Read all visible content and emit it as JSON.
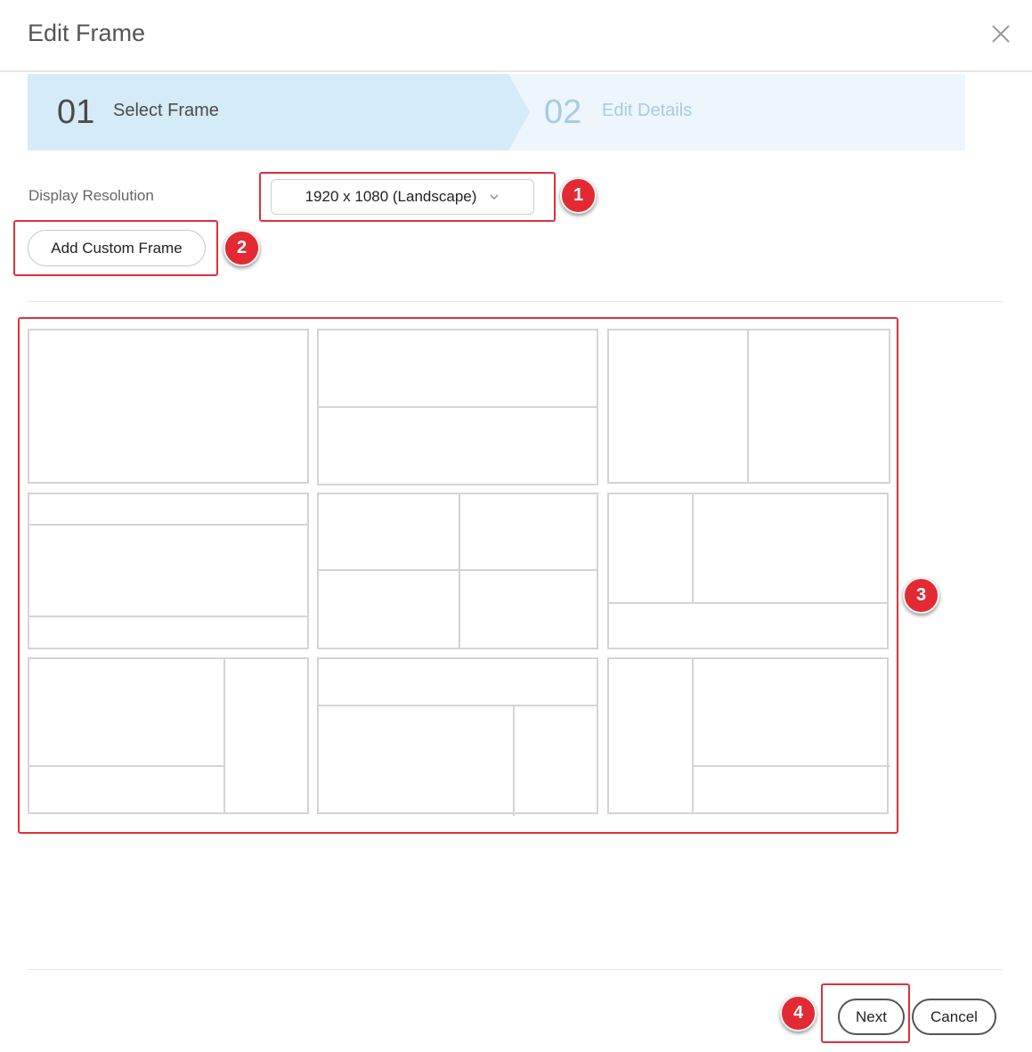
{
  "dialog": {
    "title": "Edit Frame",
    "close_icon": "close-icon"
  },
  "steps": [
    {
      "number": "01",
      "label": "Select Frame",
      "active": true
    },
    {
      "number": "02",
      "label": "Edit Details",
      "active": false
    }
  ],
  "resolution": {
    "label": "Display Resolution",
    "selected": "1920 x 1080 (Landscape)"
  },
  "add_custom_frame": "Add Custom Frame",
  "frame_layouts": [
    "single",
    "two-rows",
    "two-columns",
    "header-body-footer",
    "quad",
    "sidebar-top-with-footer",
    "main-side-with-bottom",
    "top-bar-main-side",
    "side-main-with-bottom"
  ],
  "footer": {
    "next": "Next",
    "cancel": "Cancel"
  },
  "annotations": [
    "1",
    "2",
    "3",
    "4"
  ],
  "colors": {
    "active_step_bg": "#d6ebf8",
    "inactive_step_bg": "#edf6fc",
    "inactive_step_text": "#a8cbe2",
    "annotation_red": "#e32a33"
  }
}
